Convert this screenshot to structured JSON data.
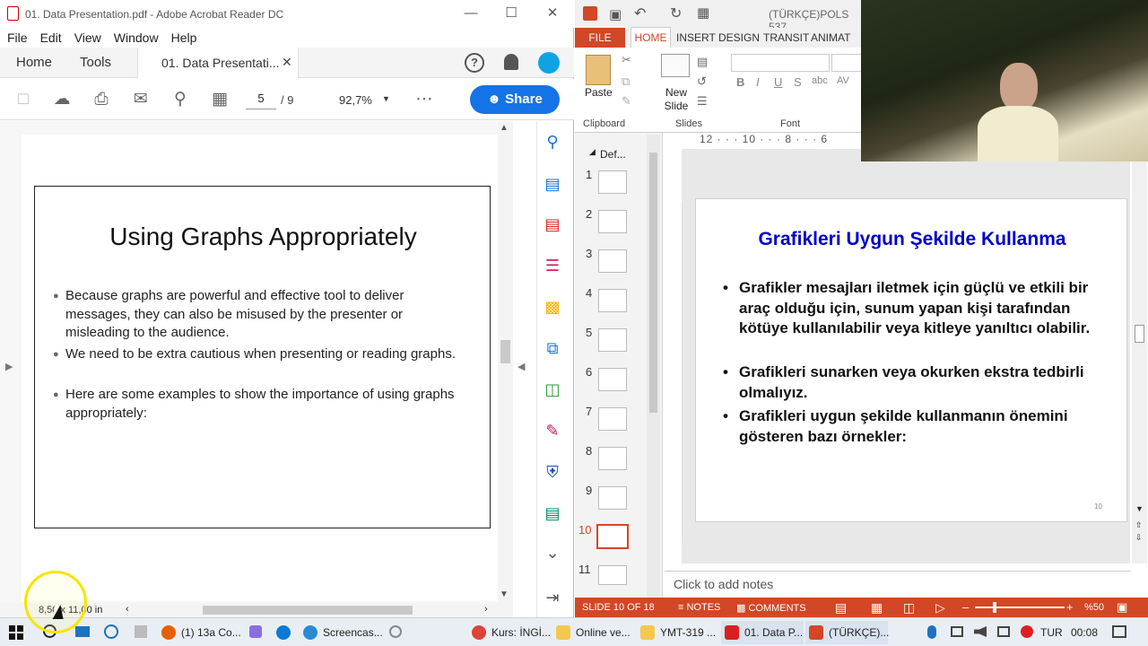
{
  "acrobat": {
    "window_title": "01. Data Presentation.pdf - Adobe Acrobat Reader DC",
    "menu": [
      "File",
      "Edit",
      "View",
      "Window",
      "Help"
    ],
    "tab_home": "Home",
    "tab_tools": "Tools",
    "tab_doc": "01. Data Presentati...",
    "page_current": "5",
    "page_total": "/ 9",
    "zoom": "92,7%",
    "share_label": "Share",
    "page_size": "8,50 x 11,00 in",
    "slide": {
      "title": "Using Graphs Appropriately",
      "bullets": [
        "Because graphs are powerful and effective tool to deliver messages, they can also be misused by the presenter or misleading to the audience.",
        "We need to be extra cautious when presenting or reading graphs.",
        "Here are some examples to show the importance of using graphs appropriately:"
      ]
    }
  },
  "powerpoint": {
    "window_title": "(TÜRKÇE)POLS 537",
    "tabs": [
      "FILE",
      "HOME",
      "INSERT",
      "DESIGN",
      "TRANSIT",
      "ANIMAT"
    ],
    "ribbon": {
      "paste": "Paste",
      "new_slide": "New Slide",
      "groups": [
        "Clipboard",
        "Slides",
        "Font"
      ]
    },
    "section_label": "Def...",
    "ruler_text": "12 · · · 10 · · · 8 · · · 6",
    "thumbnails": [
      "1",
      "2",
      "3",
      "4",
      "5",
      "6",
      "7",
      "8",
      "9",
      "10",
      "11"
    ],
    "selected_slide": "10",
    "slide": {
      "title": "Grafikleri Uygun Şekilde Kullanma",
      "bullets": [
        "Grafikler mesajları iletmek için güçlü ve etkili bir araç olduğu için, sunum yapan kişi tarafından kötüye kullanılabilir veya kitleye yanıltıcı olabilir.",
        "Grafikleri sunarken veya okurken ekstra tedbirli olmalıyız.",
        "Grafikleri uygun şekilde kullanmanın önemini gösteren bazı örnekler:"
      ],
      "number": "10"
    },
    "notes_placeholder": "Click to add notes",
    "status": {
      "slide": "SLIDE 10 OF 18",
      "notes": "NOTES",
      "comments": "COMMENTS",
      "zoom": "%50"
    }
  },
  "taskbar": {
    "items": [
      "(1) 13a Co...",
      "Screencas...",
      "Kurs: İNGİ...",
      "Online ve...",
      "YMT-319 ...",
      "01. Data P...",
      "(TÜRKÇE)..."
    ],
    "lang": "TUR",
    "time": "00:08"
  }
}
